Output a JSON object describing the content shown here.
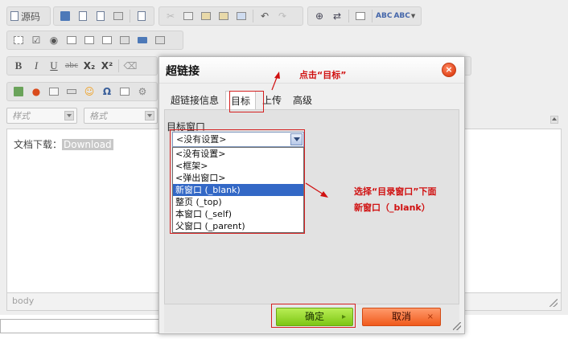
{
  "toolbar": {
    "source_label": "源码",
    "bold": "B",
    "italic": "I",
    "underline": "U",
    "strike": "abc",
    "subscript": "X₂",
    "superscript": "X²",
    "style_combo_placeholder": "样式",
    "format_combo_placeholder": "格式",
    "omega": "Ω",
    "spell_a": "ABC",
    "spell_b": "ABC"
  },
  "editor": {
    "content_label": "文档下载：",
    "content_link": "Download",
    "status_path": "body"
  },
  "dialog": {
    "title": "超链接",
    "close_symbol": "×",
    "tabs": [
      {
        "label": "超链接信息"
      },
      {
        "label": "目标"
      },
      {
        "label": "上传"
      },
      {
        "label": "高级"
      }
    ],
    "active_tab": "目标",
    "field_label": "目标窗口",
    "select_value": "<没有设置>",
    "options": [
      {
        "label": "<没有设置>"
      },
      {
        "label": "<框架>"
      },
      {
        "label": "<弹出窗口>"
      },
      {
        "label": "新窗口 (_blank)"
      },
      {
        "label": "整页 (_top)"
      },
      {
        "label": "本窗口 (_self)"
      },
      {
        "label": "父窗口 (_parent)"
      }
    ],
    "selected_option": "新窗口 (_blank)",
    "ok_label": "确定",
    "ok_symbol": "▸",
    "cancel_label": "取消",
    "cancel_symbol": "×"
  },
  "annotations": {
    "click_target": "点击“目标”",
    "choose_line1": "选择“目录窗口”下面",
    "choose_line2": "新窗口（_blank）",
    "color": "#d01010"
  },
  "colors": {
    "ok_button": "#8fd52a",
    "cancel_button": "#f26a2e",
    "selection": "#3368c6",
    "highlight_box": "#d42020"
  }
}
